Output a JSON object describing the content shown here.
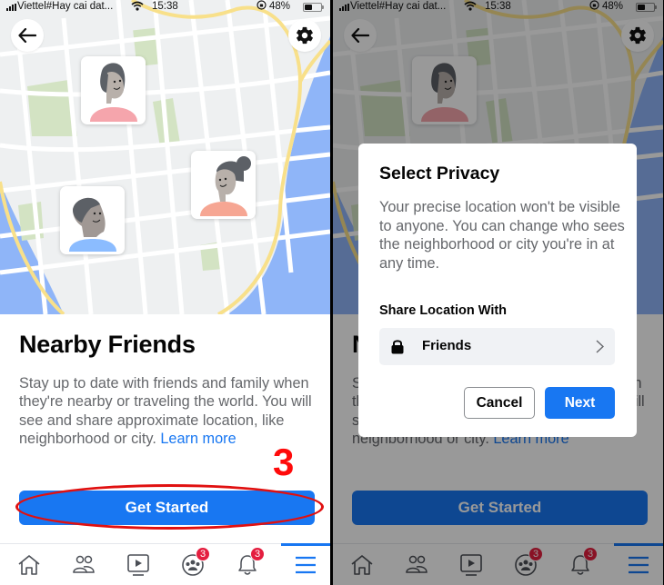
{
  "status_bar": {
    "carrier": "Viettel#Hay cai dat...",
    "time": "15:38",
    "battery_percent": "48%",
    "battery_level": 0.48
  },
  "header": {
    "back_icon": "arrow-left-icon",
    "settings_icon": "gear-icon"
  },
  "map": {
    "friends": [
      {
        "name": "friend-woman-short-hair",
        "shirt_color": "#f5a5ac"
      },
      {
        "name": "friend-woman-bun",
        "shirt_color": "#f6a693"
      },
      {
        "name": "friend-man",
        "shirt_color": "#8bbcff"
      }
    ],
    "water_color": "#8fb5f8",
    "park_color": "#d3e3c3",
    "road_color": "#f8e08a"
  },
  "intro": {
    "title": "Nearby Friends",
    "description": "Stay up to date with friends and family when they're nearby or traveling the world. You will see and share approximate location, like neighborhood or city.",
    "learn_more": "Learn more",
    "primary_button": "Get Started"
  },
  "annotation": {
    "step_number": "3",
    "color": "#ff0a0a"
  },
  "tab_bar": {
    "tabs": [
      {
        "name": "home",
        "icon": "home-icon"
      },
      {
        "name": "friends",
        "icon": "friends-icon"
      },
      {
        "name": "watch",
        "icon": "video-icon"
      },
      {
        "name": "groups",
        "icon": "groups-icon",
        "badge": "3"
      },
      {
        "name": "notifications",
        "icon": "bell-icon",
        "badge": "3"
      },
      {
        "name": "menu",
        "icon": "menu-icon",
        "active": true
      }
    ]
  },
  "dialog": {
    "title": "Select Privacy",
    "description": "Your precise location won't be visible to anyone. You can change who sees the neighborhood or city you're in at any time.",
    "share_label": "Share Location With",
    "share_value": "Friends",
    "cancel_label": "Cancel",
    "next_label": "Next"
  },
  "colors": {
    "brand_blue": "#1877f2",
    "badge_red": "#e41e3f"
  }
}
